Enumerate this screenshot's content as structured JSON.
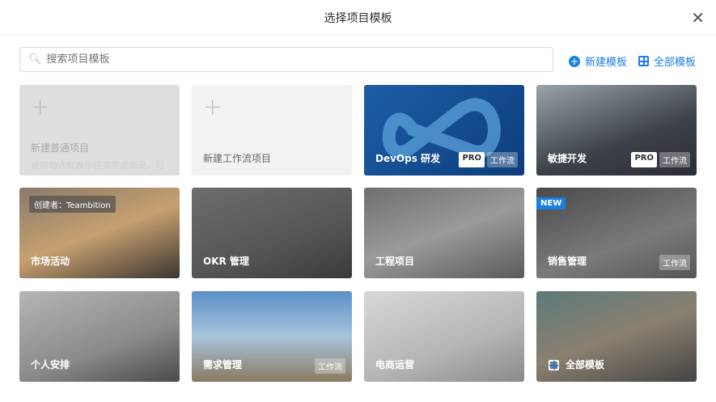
{
  "dialog": {
    "title": "选择项目模板"
  },
  "search": {
    "placeholder": "搜索项目模板"
  },
  "actions": {
    "new_template": "新建模板",
    "all_templates": "全部模板"
  },
  "cards": [
    {
      "title": "新建普通项目",
      "subtitle": "使用勾选框表示任务完成情况，可"
    },
    {
      "title": "新建工作流项目"
    },
    {
      "title": "DevOps 研发",
      "badges": [
        "PRO",
        "工作流"
      ]
    },
    {
      "title": "敏捷开发",
      "badges": [
        "PRO",
        "工作流"
      ]
    },
    {
      "title": "市场活动",
      "creator": "创建者：Teambition"
    },
    {
      "title": "OKR 管理"
    },
    {
      "title": "工程项目"
    },
    {
      "title": "销售管理",
      "new_badge": "NEW",
      "badges": [
        "工作流"
      ]
    },
    {
      "title": "个人安排"
    },
    {
      "title": "需求管理",
      "badges": [
        "工作流"
      ]
    },
    {
      "title": "电商运营"
    },
    {
      "title": "全部模板"
    }
  ]
}
